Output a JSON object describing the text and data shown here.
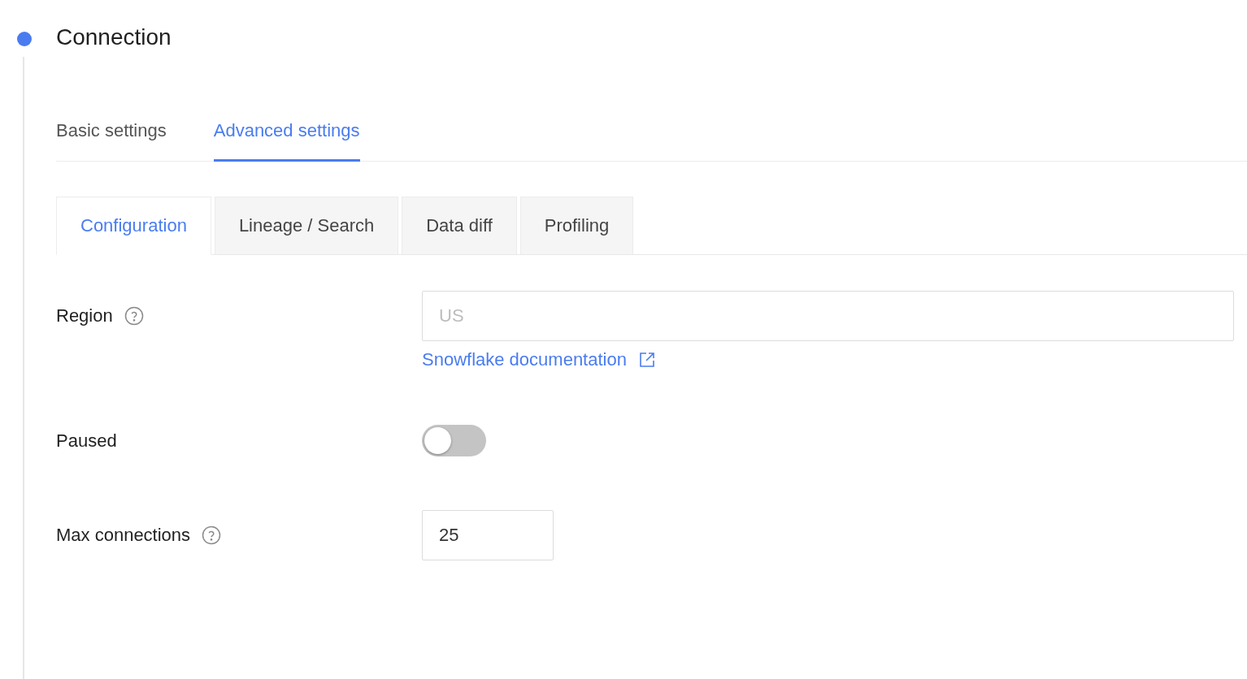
{
  "section": {
    "title": "Connection",
    "tabs": [
      {
        "label": "Basic settings",
        "selected": false
      },
      {
        "label": "Advanced settings",
        "selected": true
      }
    ],
    "subtabs": [
      {
        "label": "Configuration",
        "selected": true
      },
      {
        "label": "Lineage / Search",
        "selected": false
      },
      {
        "label": "Data diff",
        "selected": false
      },
      {
        "label": "Profiling",
        "selected": false
      }
    ],
    "fields": [
      {
        "kind": "text",
        "label": "Region",
        "help": true,
        "placeholder": "US",
        "link": "Snowflake documentation"
      },
      {
        "kind": "switch",
        "label": "Paused",
        "help": false,
        "on": false
      },
      {
        "kind": "number",
        "label": "Max connections",
        "help": true,
        "value": "25"
      }
    ]
  }
}
